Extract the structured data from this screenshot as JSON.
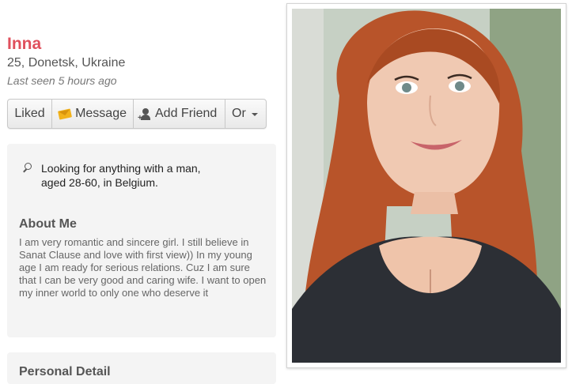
{
  "profile": {
    "name": "Inna",
    "meta": "25, Donetsk, Ukraine",
    "last_seen": "Last seen 5 hours ago"
  },
  "actions": {
    "liked": "Liked",
    "message": "Message",
    "add_friend": "Add Friend",
    "more": "Or"
  },
  "looking_for": "Looking for anything with a man, aged 28-60, in Belgium.",
  "about": {
    "title": "About Me",
    "text": "I am very romantic and sincere girl. I still believe in\nSanat Clause and love with first view)) In my young age I am ready for serious relations. Cuz I am sure that I can be very good and caring wife. I want to open my inner world to only one who deserve it"
  },
  "personal_details": {
    "title": "Personal Detail"
  },
  "colors": {
    "name_accent": "#e0505d",
    "card_bg": "#f4f4f4"
  }
}
